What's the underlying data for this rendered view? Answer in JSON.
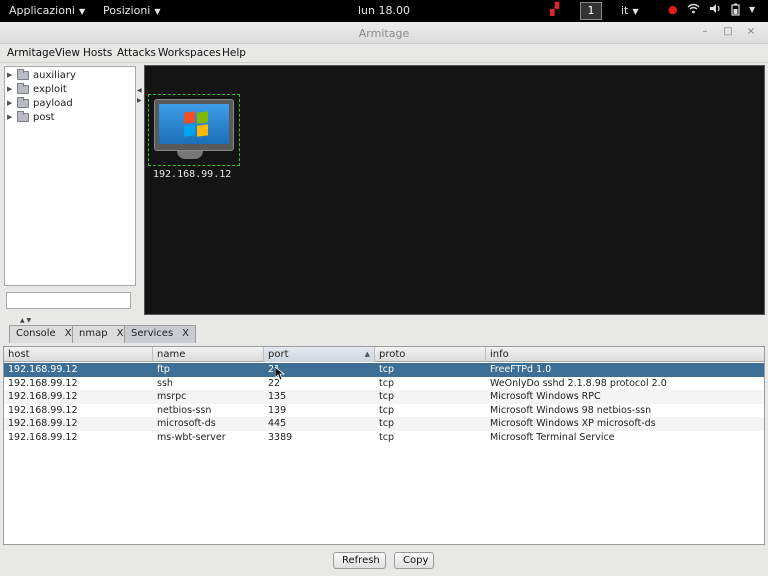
{
  "top_panel": {
    "applications": "Applicazioni",
    "places": "Posizioni",
    "clock": "lun 18.00",
    "workspace": "1",
    "keyboard_layout": "it",
    "icons": [
      "armitage-tray-icon",
      "record-icon",
      "wifi-icon",
      "volume-icon",
      "battery-icon",
      "chevron-down-icon"
    ]
  },
  "window": {
    "title": "Armitage",
    "controls": [
      "–",
      "□",
      "×"
    ]
  },
  "menu": [
    "Armitage",
    "View",
    "Hosts",
    "Attacks",
    "Workspaces",
    "Help"
  ],
  "module_tree": [
    "auxiliary",
    "exploit",
    "payload",
    "post"
  ],
  "search": {
    "value": ""
  },
  "graph": {
    "host": {
      "ip": "192.168.99.12",
      "os_icon": "windows-monitor-icon"
    }
  },
  "tabs": [
    {
      "label": "Console",
      "close": "X"
    },
    {
      "label": "nmap",
      "close": "X"
    },
    {
      "label": "Services",
      "close": "X"
    }
  ],
  "services_table": {
    "columns": [
      "host",
      "name",
      "port",
      "proto",
      "info"
    ],
    "sorted_column": "port",
    "rows": [
      [
        "192.168.99.12",
        "ftp",
        "21",
        "tcp",
        "FreeFTPd 1.0"
      ],
      [
        "192.168.99.12",
        "ssh",
        "22",
        "tcp",
        "WeOnlyDo sshd 2.1.8.98 protocol 2.0"
      ],
      [
        "192.168.99.12",
        "msrpc",
        "135",
        "tcp",
        "Microsoft Windows RPC"
      ],
      [
        "192.168.99.12",
        "netbios-ssn",
        "139",
        "tcp",
        "Microsoft Windows 98 netbios-ssn"
      ],
      [
        "192.168.99.12",
        "microsoft-ds",
        "445",
        "tcp",
        "Microsoft Windows XP microsoft-ds"
      ],
      [
        "192.168.99.12",
        "ms-wbt-server",
        "3389",
        "tcp",
        "Microsoft Terminal Service"
      ]
    ]
  },
  "buttons": {
    "refresh": "Refresh",
    "copy": "Copy"
  },
  "colors": {
    "selection": "#3d6e95",
    "graph_bg": "#141414",
    "node_outline": "#3cbc3c"
  }
}
